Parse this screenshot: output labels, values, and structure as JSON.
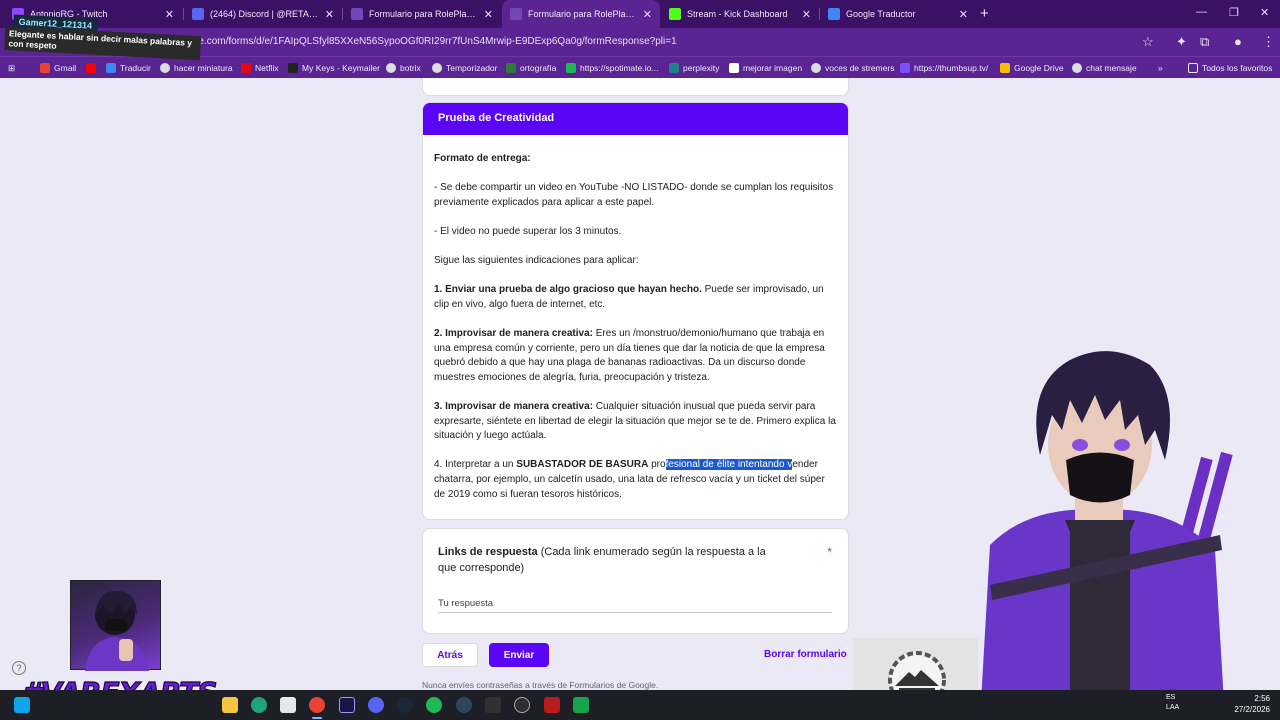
{
  "browser": {
    "tabs": [
      {
        "title": "AntonioRG - Twitch",
        "favicon_color": "#9146ff",
        "active": false
      },
      {
        "title": "(2464) Discord | @RETALIURGIC",
        "favicon_color": "#5865f2",
        "active": false
      },
      {
        "title": "Formulario para RolePlayers EU",
        "favicon_color": "#7248b9",
        "active": false
      },
      {
        "title": "Formulario para RolePlayers EU",
        "favicon_color": "#7248b9",
        "active": true
      },
      {
        "title": "Stream - Kick Dashboard",
        "favicon_color": "#53fc18",
        "active": false
      },
      {
        "title": "Google Traductor",
        "favicon_color": "#4285f4",
        "active": false
      }
    ],
    "url": "docs.google.com/forms/d/e/1FAIpQLSfyl85XXeN56SypoOGf0RI29rr7fUnS4Mrwip-E9DExp6Qa0g/formResponse?pli=1",
    "bookmarks": [
      {
        "label": "Gmail",
        "color": "#ea4335"
      },
      {
        "label": "",
        "color": "#ff0000"
      },
      {
        "label": "Traducir",
        "color": "#4285f4"
      },
      {
        "label": "hacer miniatura",
        "color": "#dddddd"
      },
      {
        "label": "Netflix",
        "color": "#e50914"
      },
      {
        "label": "My Keys - Keymailer",
        "color": "#222222"
      },
      {
        "label": "botrix",
        "color": "#dddddd"
      },
      {
        "label": "Temporizador",
        "color": "#dddddd"
      },
      {
        "label": "ortografía",
        "color": "#2e7d32"
      },
      {
        "label": "https://spotimate.io...",
        "color": "#1db954"
      },
      {
        "label": "perplexity",
        "color": "#20808d"
      },
      {
        "label": "mejorar imagen",
        "color": "#ffffff"
      },
      {
        "label": "voces de stremers",
        "color": "#dddddd"
      },
      {
        "label": "https://thumbsup.tv/",
        "color": "#7c4dff"
      },
      {
        "label": "Google Drive",
        "color": "#fbbc04"
      },
      {
        "label": "chat mensaje",
        "color": "#dddddd"
      }
    ],
    "bookmarks_all": "Todos los favoritos"
  },
  "chat_overlay": {
    "username": "Gamer12_121314",
    "message": "Elegante es hablar sin decir malas palabras y con respeto"
  },
  "form": {
    "section_title": "Prueba de Creatividad",
    "delivery_heading": "Formato de entrega:",
    "delivery_p1": "- Se debe compartir un video en YouTube -NO LISTADO- donde se cumplan los requisitos previamente explicados para aplicar a este papel.",
    "delivery_p2": "- El video no puede superar los 3 minutos.",
    "instructions_intro": "Sigue las siguientes indicaciones para aplicar:",
    "item1_bold": "1. Enviar una prueba de algo gracioso que hayan hecho.",
    "item1_text": " Puede ser improvisado, un clip en vivo, algo fuera de internet, etc.",
    "item2_bold": "2. Improvisar de manera creativa:",
    "item2_text": " Eres un /monstruo/demonio/humano que trabaja en una empresa común y corriente, pero un día tienes que dar la noticia de que la empresa quebró debido a que hay una plaga de bananas radioactivas. Da un discurso donde muestres emociones de alegría, furia, preocupación y tristeza.",
    "item3_bold": "3. Improvisar de manera creativa:",
    "item3_text": " Cualquier situación inusual que pueda servir para expresarte, siéntete en libertad de elegir la situación que mejor se te de. Primero explica la situación y luego actúala.",
    "item4_pre": "4. Interpretar a un ",
    "item4_bold": "SUBASTADOR DE BASURA",
    "item4_a": " pro",
    "item4_selected": "fesional de élite intentando v",
    "item4_b": "ender chatarra, por ejemplo, un calcetín usado, una lata de refresco vacía y un ticket del súper de 2019 como si fueran tesoros históricos.",
    "links_label_bold": "Links de respuesta",
    "links_label_rest": " (Cada link enumerado según la respuesta a la que corresponde)",
    "required_mark": "*",
    "answer_placeholder": "Tu respuesta",
    "back_label": "Atrás",
    "submit_label": "Enviar",
    "clear_label": "Borrar formulario",
    "disclaimer": "Nunca envíes contraseñas a través de Formularios de Google.",
    "accent_color": "#5a05f5"
  },
  "overlay": {
    "brand": "#VAREXARTS"
  },
  "taskbar": {
    "lang_line1": "ES",
    "lang_line2": "LAA",
    "time": "2:56",
    "date": "27/2/2026",
    "apps": [
      "windows",
      "search",
      "taskview",
      "widgets",
      "file-explorer",
      "edge",
      "store",
      "chrome",
      "premiere",
      "discord",
      "steam",
      "spotify",
      "steam-2",
      "epic",
      "obs",
      "app-red",
      "app-green"
    ]
  }
}
